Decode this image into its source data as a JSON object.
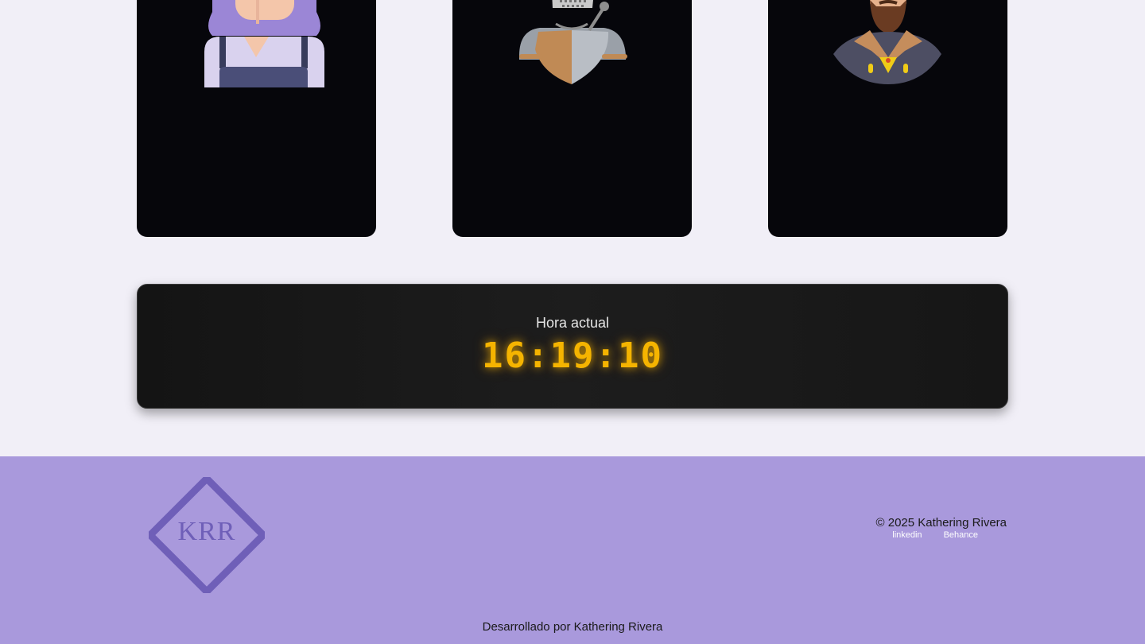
{
  "cards": [
    {
      "avatar_icon": "woman-apron-avatar-icon"
    },
    {
      "avatar_icon": "knight-armor-avatar-icon"
    },
    {
      "avatar_icon": "bearded-king-avatar-icon"
    }
  ],
  "clock": {
    "label": "Hora actual",
    "time": "16:19:10",
    "time_color": "#f5b400"
  },
  "footer": {
    "logo_text": "KRR",
    "copyright": "© 2025 Kathering Rivera",
    "links": [
      {
        "label": "linkedin"
      },
      {
        "label": "Behance"
      }
    ],
    "credit": "Desarrollado por Kathering Rivera",
    "background_color": "#a999dc"
  }
}
